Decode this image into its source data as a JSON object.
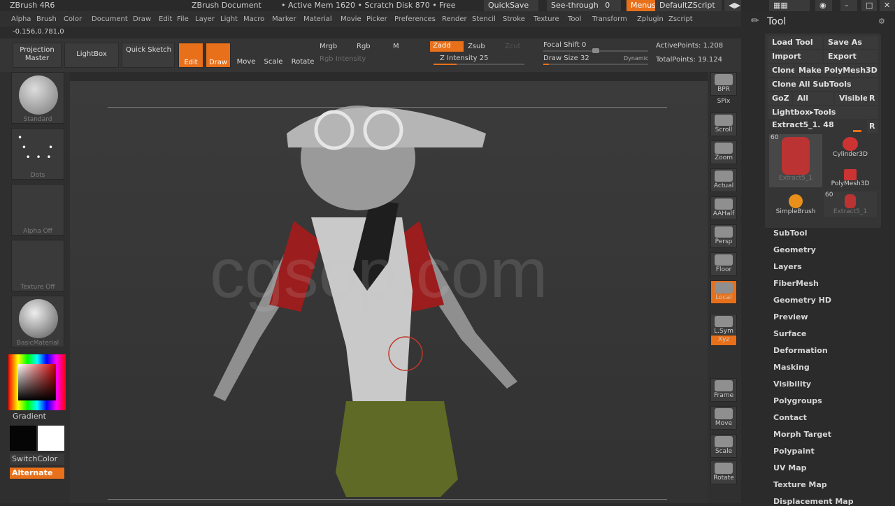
{
  "title_bar": {
    "app": "ZBrush 4R6",
    "document": "ZBrush Document",
    "status": "• Active Mem 1620 • Scratch Disk 870 • Free",
    "quicksave": "QuickSave",
    "see_through_label": "See-through",
    "see_through_value": "0",
    "menus": "Menus",
    "default_zscript": "DefaultZScript"
  },
  "menus": [
    "Alpha",
    "Brush",
    "Color",
    "Document",
    "Draw",
    "Edit",
    "File",
    "Layer",
    "Light",
    "Macro",
    "Marker",
    "Material",
    "Movie",
    "Picker",
    "Preferences",
    "Render",
    "Stencil",
    "Stroke",
    "Texture",
    "Tool",
    "Transform",
    "Zplugin",
    "Zscript"
  ],
  "coords": "-0.156,0.781,0",
  "shelf": {
    "projection_master": "Projection Master",
    "lightbox": "LightBox",
    "quick_sketch": "Quick Sketch",
    "edit": "Edit",
    "draw": "Draw",
    "move": "Move",
    "scale": "Scale",
    "rotate": "Rotate",
    "mrgb": "Mrgb",
    "rgb": "Rgb",
    "m": "M",
    "rgb_intensity": "Rgb Intensity",
    "zadd": "Zadd",
    "zsub": "Zsub",
    "zcut": "Zcut",
    "z_intensity": "Z Intensity 25",
    "focal_shift": "Focal Shift 0",
    "draw_size": "Draw Size 32",
    "dynamic": "Dynamic",
    "active_points": "ActivePoints: 1.208",
    "total_points": "TotalPoints: 19.124"
  },
  "sliders": {
    "z_intensity": 0.25,
    "focal_shift": 0.5,
    "draw_size": 0.05
  },
  "left_panel": {
    "brush": "Standard",
    "stroke": "Dots",
    "alpha": "Alpha Off",
    "texture": "Texture Off",
    "material": "BasicMaterial",
    "gradient": "Gradient",
    "switch_color": "SwitchColor",
    "alternate": "Alternate"
  },
  "canvas": {
    "watermark": "cgsop.com"
  },
  "right_bar": [
    "BPR",
    "SPix",
    "Scroll",
    "Zoom",
    "Actual",
    "AAHalf",
    "Persp",
    "Floor",
    "Local",
    "L.Sym",
    "Xyz",
    "Frame",
    "Move",
    "Scale",
    "Rotate"
  ],
  "tool_panel": {
    "title": "Tool",
    "load_tool": "Load Tool",
    "save_as": "Save As",
    "import": "Import",
    "export": "Export",
    "clone": "Clone",
    "make_polymesh": "Make PolyMesh3D",
    "clone_all": "Clone All SubTools",
    "goz": "GoZ",
    "all": "All",
    "visible": "Visible",
    "r": "R",
    "lightbox_tools": "Lightbox▸Tools",
    "current_tool": "Extract5_1. 48",
    "thumbs": [
      {
        "label": "Extract5_1",
        "count": "60"
      },
      {
        "label": "Cylinder3D",
        "count": ""
      },
      {
        "label": "PolyMesh3D",
        "count": ""
      },
      {
        "label": "SimpleBrush",
        "count": ""
      },
      {
        "label": "Extract5_1",
        "count": "60"
      }
    ],
    "sections": [
      "SubTool",
      "Geometry",
      "Layers",
      "FiberMesh",
      "Geometry HD",
      "Preview",
      "Surface",
      "Deformation",
      "Masking",
      "Visibility",
      "Polygroups",
      "Contact",
      "Morph Target",
      "Polypaint",
      "UV Map",
      "Texture Map",
      "Displacement Map"
    ]
  },
  "colors": {
    "accent": "#e8701a",
    "bg": "#2b2b2b"
  }
}
